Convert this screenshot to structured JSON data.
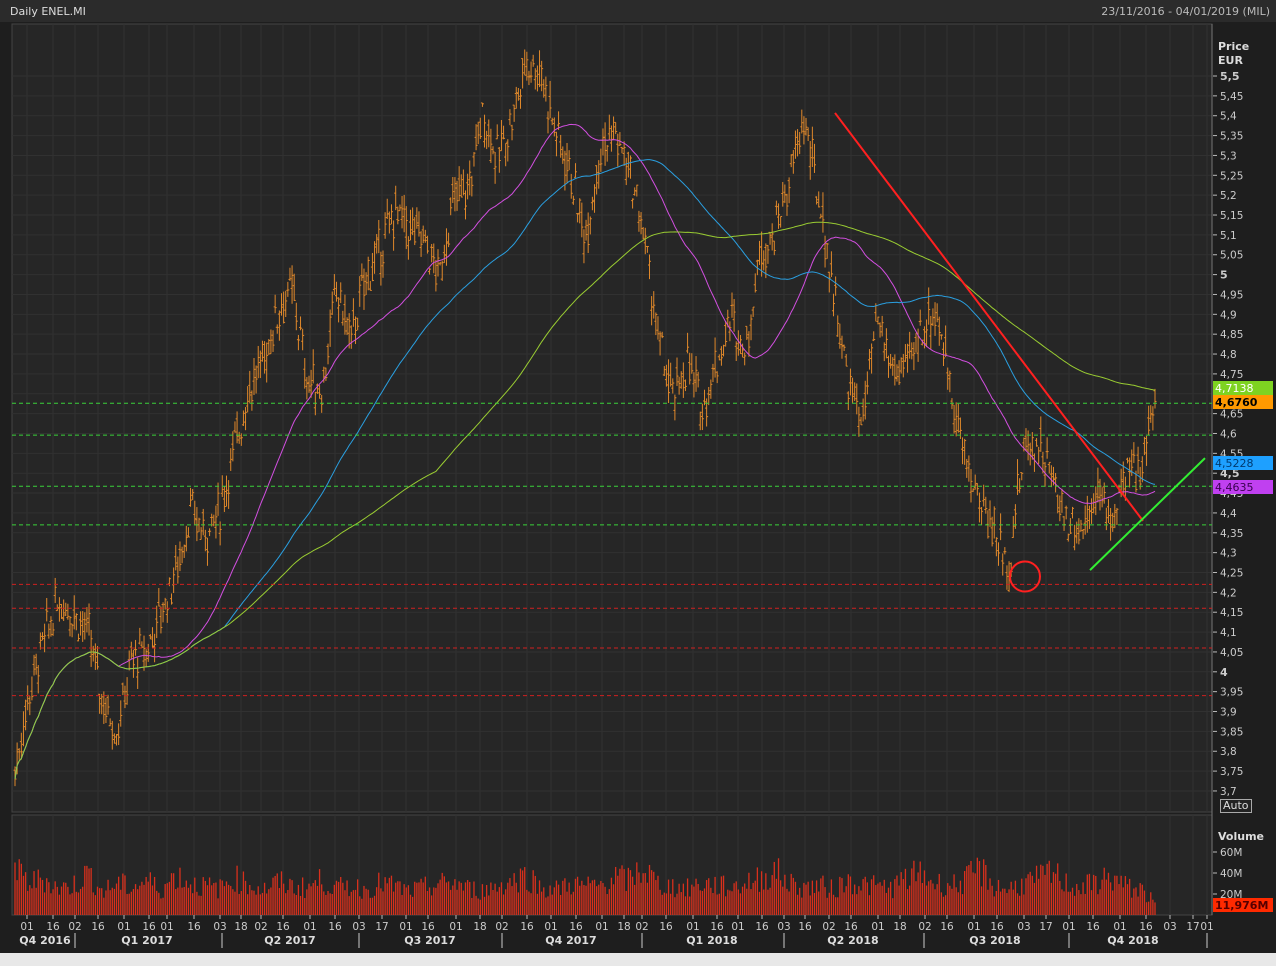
{
  "header": {
    "title": "Daily ENEL.MI",
    "range": "23/11/2016 - 04/01/2019 (MIL)"
  },
  "price_axis": {
    "label1": "Price",
    "label2": "EUR",
    "auto": "Auto"
  },
  "volume_axis": {
    "label": "Volume",
    "ticks": [
      "60M",
      "40M",
      "20M"
    ],
    "auto": "Auto"
  },
  "badges": [
    {
      "text": "4,7138",
      "value": 4.7138,
      "color": "#7ed321",
      "textcolor": "#ffffff"
    },
    {
      "text": "4,6760",
      "value": 4.676,
      "color": "#ff9900",
      "textcolor": "#000000"
    },
    {
      "text": "4,5228",
      "value": 4.5228,
      "color": "#1ea0ff",
      "textcolor": "#003a70"
    },
    {
      "text": "4,4635",
      "value": 4.4635,
      "color": "#c040f0",
      "textcolor": "#3a0050"
    },
    {
      "text": "11,976M",
      "value": 11.976,
      "color": "#ff2a00",
      "textcolor": "#550000"
    }
  ],
  "chart_data": {
    "type": "ohlc",
    "title": "Daily ENEL.MI",
    "ylabel": "Price EUR",
    "ylim": [
      3.7,
      5.5
    ],
    "y_ticks": [
      "5,5",
      "5,45",
      "5,4",
      "5,35",
      "5,3",
      "5,25",
      "5,2",
      "5,15",
      "5,1",
      "5,05",
      "5",
      "4,95",
      "4,9",
      "4,85",
      "4,8",
      "4,75",
      "4,7",
      "4,65",
      "4,6",
      "4,55",
      "4,5",
      "4,45",
      "4,4",
      "4,35",
      "4,3",
      "4,25",
      "4,2",
      "4,15",
      "4,1",
      "4,05",
      "4",
      "3,95",
      "3,9",
      "3,85",
      "3,8",
      "3,75",
      "3,7"
    ],
    "y_tick_values": [
      5.5,
      5.45,
      5.4,
      5.35,
      5.3,
      5.25,
      5.2,
      5.15,
      5.1,
      5.05,
      5.0,
      4.95,
      4.9,
      4.85,
      4.8,
      4.75,
      4.7,
      4.65,
      4.6,
      4.55,
      4.5,
      4.45,
      4.4,
      4.35,
      4.3,
      4.25,
      4.2,
      4.15,
      4.1,
      4.05,
      4.0,
      3.95,
      3.9,
      3.85,
      3.8,
      3.75,
      3.7
    ],
    "x_ticks": [
      "01",
      "16",
      "02",
      "16",
      "01",
      "16",
      "01",
      "16",
      "03",
      "18",
      "02",
      "16",
      "01",
      "16",
      "03",
      "17",
      "01",
      "16",
      "01",
      "18",
      "02",
      "16",
      "01",
      "16",
      "01",
      "18",
      "02",
      "16",
      "01",
      "16",
      "01",
      "16",
      "03",
      "16",
      "02",
      "16",
      "01",
      "18",
      "02",
      "16",
      "01",
      "16",
      "03",
      "17",
      "01",
      "16",
      "01",
      "16",
      "03",
      "17",
      "01"
    ],
    "quarters": [
      "Q4 2016",
      "Q1 2017",
      "Q2 2017",
      "Q3 2017",
      "Q4 2017",
      "Q1 2018",
      "Q2 2018",
      "Q3 2018",
      "Q4 2018"
    ],
    "approx_closes": [
      3.75,
      3.95,
      4.08,
      4.18,
      4.15,
      4.1,
      3.93,
      3.85,
      4.03,
      4.05,
      4.15,
      4.25,
      4.4,
      4.35,
      4.4,
      4.56,
      4.71,
      4.78,
      4.91,
      4.96,
      4.73,
      4.71,
      4.96,
      4.84,
      4.99,
      5.06,
      5.16,
      5.11,
      5.09,
      4.99,
      5.19,
      5.21,
      5.41,
      5.29,
      5.39,
      5.54,
      5.51,
      5.36,
      5.26,
      5.09,
      5.31,
      5.36,
      5.26,
      5.11,
      4.84,
      4.68,
      4.78,
      4.66,
      4.78,
      4.89,
      4.81,
      5.06,
      5.11,
      5.24,
      5.39,
      5.19,
      4.96,
      4.73,
      4.63,
      4.89,
      4.76,
      4.76,
      4.86,
      4.91,
      4.73,
      4.53,
      4.43,
      4.36,
      4.26,
      4.56,
      4.58,
      4.48,
      4.38,
      4.36,
      4.46,
      4.38,
      4.48,
      4.53,
      4.68
    ],
    "moving_averages": [
      {
        "name": "MA short",
        "color": "#d24fe0",
        "period": 50,
        "last": 4.4635
      },
      {
        "name": "MA medium",
        "color": "#2a9fe0",
        "period": 100,
        "last": 4.5228
      },
      {
        "name": "MA long",
        "color": "#9acd32",
        "period": 200,
        "last": 4.7138
      }
    ],
    "last_close": 4.676,
    "horizontal_levels": {
      "support_green": [
        4.676,
        4.596,
        4.467,
        4.37
      ],
      "support_red": [
        4.22,
        4.16,
        4.06,
        3.94
      ]
    },
    "trendlines": [
      {
        "name": "downtrend",
        "color": "#ff2020",
        "from": 5.407,
        "to": 4.38
      },
      {
        "name": "uptrend",
        "color": "#33ee33",
        "from": 4.256,
        "to": 4.538
      }
    ],
    "annotation_circle": {
      "color": "#ff2020",
      "price": 4.24
    },
    "volume": {
      "ylim_millions": [
        0,
        80
      ],
      "last_millions": 11.976,
      "approx_millions": [
        42,
        30,
        35,
        25,
        28,
        40,
        22,
        30,
        26,
        33,
        24,
        38,
        30,
        27,
        25,
        35,
        29,
        24,
        31,
        27,
        26,
        33,
        25,
        28,
        24,
        30,
        27,
        22,
        26,
        29,
        31,
        25,
        23,
        28,
        32,
        38,
        26,
        24,
        30,
        27,
        28,
        36,
        33,
        45,
        29,
        27,
        25,
        30,
        28,
        26,
        31,
        34,
        42,
        30,
        26,
        28,
        24,
        33,
        29,
        27,
        26,
        35,
        39,
        30,
        28,
        32,
        44,
        27,
        25,
        30,
        34,
        40,
        29,
        26,
        31,
        36,
        27,
        24,
        12
      ]
    }
  }
}
